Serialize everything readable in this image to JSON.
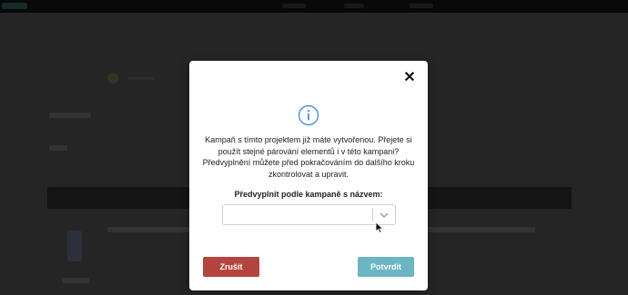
{
  "dialog": {
    "close_glyph": "✕",
    "info_icon": "info-circle-icon",
    "message": "Kampaň s tímto projektem již máte vytvořenou. Přejete si použít stejné párování elementů i v této kampani? Předvyplnění můžete před pokračováním do dalšího kroku zkontrolovat a upravit.",
    "select_label": "Předvyplnit podle kampaně s názvem:",
    "select_value": "",
    "cancel_label": "Zrušit",
    "confirm_label": "Potvrdit"
  },
  "colors": {
    "accent_info": "#4a8fe0",
    "cancel": "#b3443f",
    "confirm": "#6cb5c3"
  }
}
